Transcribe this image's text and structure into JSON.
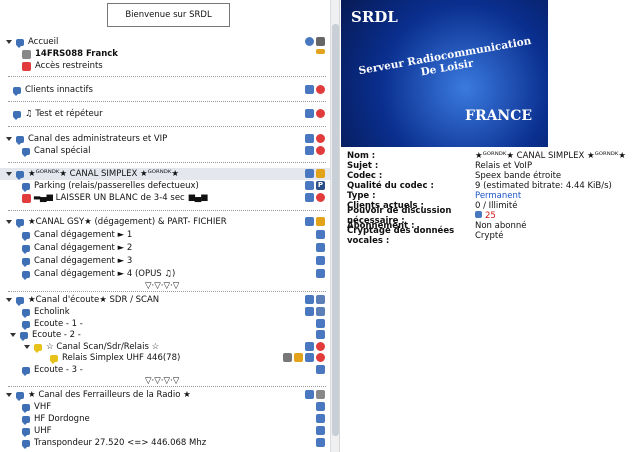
{
  "banner": "Bienvenue sur SRDL",
  "tree": [
    {
      "id": "accueil",
      "label": "Accueil",
      "bold": false
    },
    {
      "id": "user",
      "label": "14FRS088 Franck",
      "bold": true
    },
    {
      "id": "acces",
      "label": "Accès restreints",
      "bold": false
    },
    {
      "id": "inactifs",
      "label": "Clients innactifs",
      "bold": false
    },
    {
      "id": "test",
      "label": "Test et répéteur",
      "bold": false
    },
    {
      "id": "admin",
      "label": "Canal des administrateurs et VIP",
      "bold": false
    },
    {
      "id": "special",
      "label": "Canal spécial",
      "bold": false
    },
    {
      "id": "simplex",
      "label": "★ᴳᴼᴿᴺᴰᴷ★  CANAL SIMPLEX  ★ᴳᴼᴿᴺᴰᴷ★",
      "bold": false
    },
    {
      "id": "parking",
      "label": "Parking (relais/passerelles defectueux)",
      "bold": false
    },
    {
      "id": "blanc",
      "label": "LAISSER UN BLANC de 3-4 sec",
      "bold": false
    },
    {
      "id": "gsy",
      "label": "★CANAL GSY★ (dégagement) & PART- FICHIER",
      "bold": false
    },
    {
      "id": "deg1",
      "label": "Canal dégagement ► 1",
      "bold": false
    },
    {
      "id": "deg2",
      "label": "Canal dégagement ► 2",
      "bold": false
    },
    {
      "id": "deg3",
      "label": "Canal dégagement ► 3",
      "bold": false
    },
    {
      "id": "deg4",
      "label": "Canal dégagement ► 4  (OPUS ♫)",
      "bold": false
    },
    {
      "id": "sep1",
      "label": "▽·▽·▽·▽",
      "bold": false
    },
    {
      "id": "ecoute",
      "label": "★Canal d'écoute★ SDR / SCAN",
      "bold": false
    },
    {
      "id": "echolink",
      "label": "Echolink",
      "bold": false
    },
    {
      "id": "ec1",
      "label": "Ecoute - 1 -",
      "bold": false
    },
    {
      "id": "ec2",
      "label": "Ecoute - 2 -",
      "bold": false
    },
    {
      "id": "scan",
      "label": "☆ Canal Scan/Sdr/Relais ☆",
      "bold": false
    },
    {
      "id": "relais",
      "label": "Relais Simplex  UHF 446(78)",
      "bold": false
    },
    {
      "id": "ec3",
      "label": "Ecoute - 3 -",
      "bold": false
    },
    {
      "id": "sep2",
      "label": "▽·▽·▽·▽",
      "bold": false
    },
    {
      "id": "ferrailleurs",
      "label": "★ Canal des Ferrailleurs de la Radio ★",
      "bold": false
    },
    {
      "id": "vhf",
      "label": "VHF",
      "bold": false
    },
    {
      "id": "hfd",
      "label": "HF Dordogne",
      "bold": false
    },
    {
      "id": "uhf",
      "label": "UHF",
      "bold": false
    },
    {
      "id": "transp",
      "label": "Transpondeur 27.520 <=> 446.068 Mhz",
      "bold": false
    }
  ],
  "logo": {
    "top": "SRDL",
    "middle": "Serveur Radiocommunication De Loisir",
    "bottom": "FRANCE"
  },
  "info": [
    {
      "k": "Nom :",
      "v": "★ᴳᴼᴿᴺᴰᴷ★  CANAL SIMPLEX  ★ᴳᴼᴿᴺᴰᴷ★"
    },
    {
      "k": "Sujet :",
      "v": "Relais et VoIP"
    },
    {
      "k": "Codec :",
      "v": "Speex bande étroite"
    },
    {
      "k": "Qualité du codec :",
      "v": "9 (estimated bitrate: 4.44 KiB/s)"
    },
    {
      "k": "Type :",
      "v": "Permanent"
    },
    {
      "k": "Clients actuels :",
      "v": "0 / Illimité"
    },
    {
      "k": "Pouvoir de discussion nécessaire :",
      "v": "25"
    },
    {
      "k": "Abonnement :",
      "v": "Non abonné"
    },
    {
      "k": "Cryptage des données vocales :",
      "v": "Crypté"
    }
  ],
  "colors": {
    "channel": "#3f6fb5",
    "permanent": "#1a55c8",
    "power": "#d41616"
  }
}
